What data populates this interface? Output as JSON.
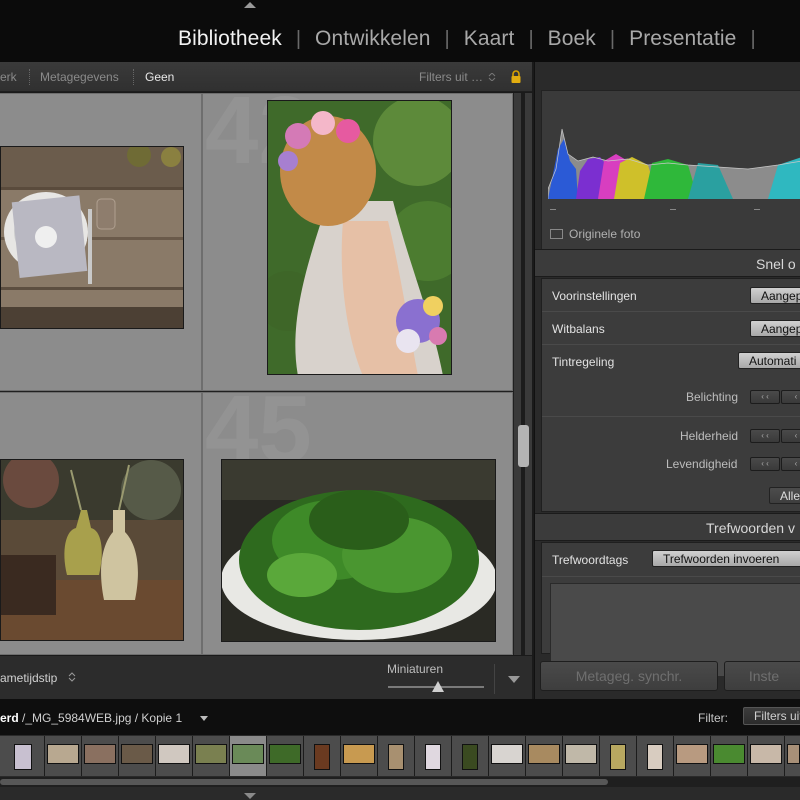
{
  "modules": {
    "items": [
      {
        "label": "Bibliotheek",
        "active": true
      },
      {
        "label": "Ontwikkelen",
        "active": false
      },
      {
        "label": "Kaart",
        "active": false
      },
      {
        "label": "Boek",
        "active": false
      },
      {
        "label": "Presentatie",
        "active": false
      }
    ],
    "separator": "|"
  },
  "filter_bar": {
    "partial_left": "erk",
    "metadata": "Metagegevens",
    "none": "Geen",
    "filters_off": "Filters uit …"
  },
  "grid": {
    "cell_numbers": [
      "42",
      "45"
    ]
  },
  "toolbar": {
    "sort_label": "ametijdstip",
    "thumbnails_label": "Miniaturen",
    "thumbnail_size": 0.52
  },
  "right_panel": {
    "histogram": {
      "original_photo_label": "Originele foto",
      "original_photo_checked": false
    },
    "quick_develop": {
      "title": "Snel o",
      "preset_label": "Voorinstellingen",
      "preset_value": "Aangep",
      "white_balance_label": "Witbalans",
      "white_balance_value": "Aangep",
      "tone_label": "Tintregeling",
      "tone_value": "Automati",
      "exposure_label": "Belichting",
      "clarity_label": "Helderheid",
      "vibrance_label": "Levendigheid",
      "reset_all": "Alle",
      "step_left": "‹ ‹",
      "step_right": "‹"
    },
    "keywords": {
      "title": "Trefwoorden v",
      "tags_label": "Trefwoordtags",
      "tags_value": "Trefwoorden invoeren"
    },
    "sync_metadata": "Metageg. synchr.",
    "sync_settings": "Inste"
  },
  "filmstrip": {
    "path_bold": "erd",
    "path_rest": " /_MG_5984WEB.jpg / Kopie 1",
    "filter_label": "Filter:",
    "filter_value": "Filters uit"
  },
  "colors": {
    "accent_active": "#f2f2f2",
    "panel_bg": "#2a2a2a",
    "grid_cell": "#8c8c8c"
  }
}
